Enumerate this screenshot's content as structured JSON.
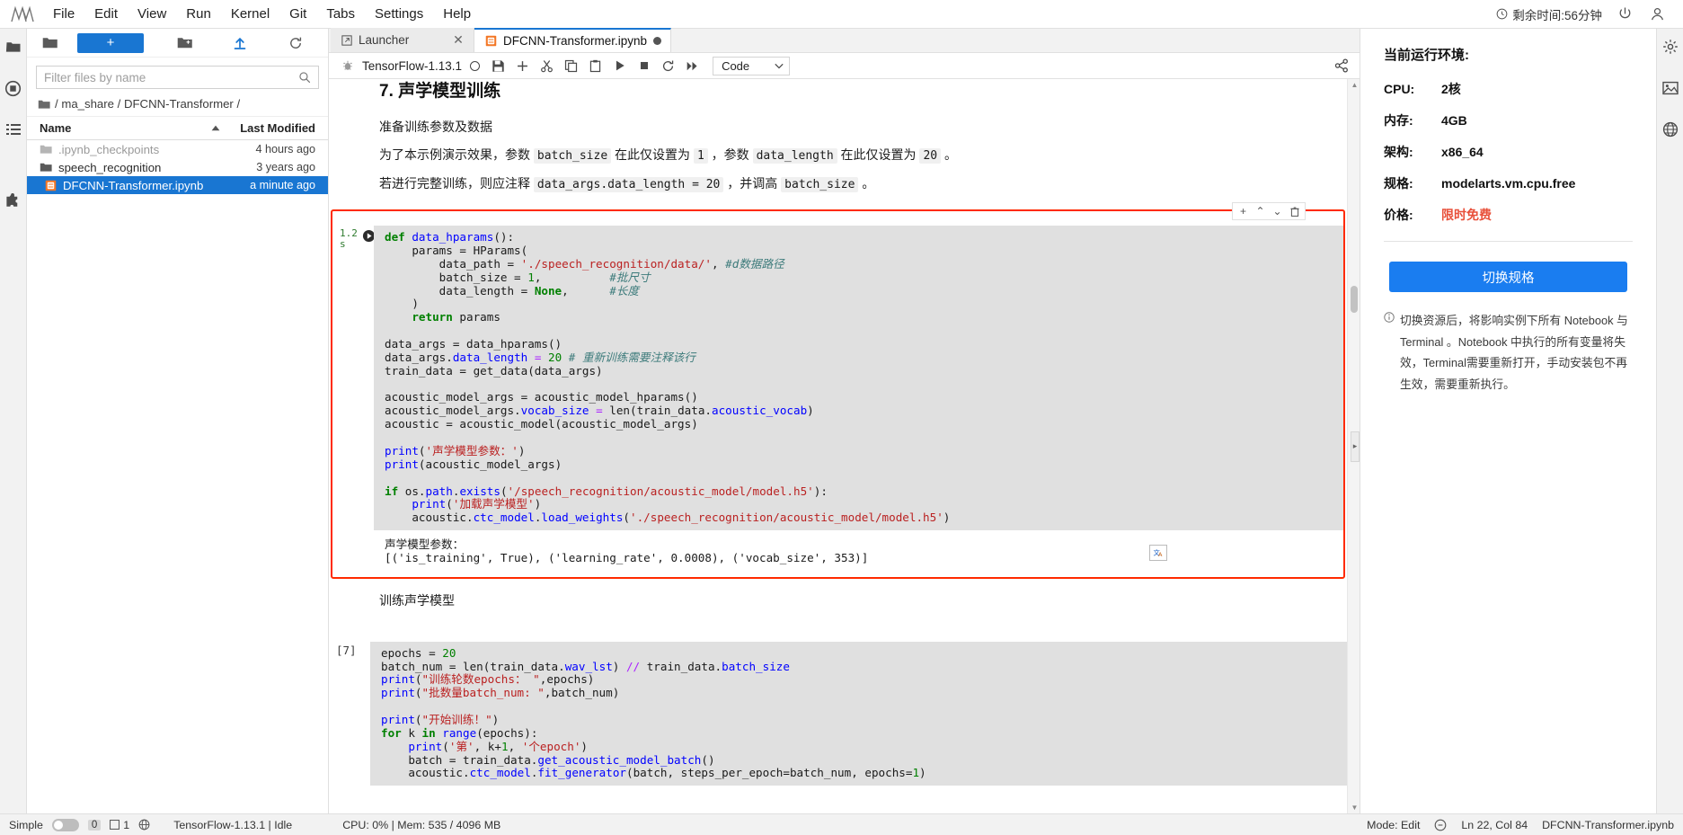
{
  "menubar": {
    "logo_name": "jupyterlab-logo",
    "items": [
      "File",
      "Edit",
      "View",
      "Run",
      "Kernel",
      "Git",
      "Tabs",
      "Settings",
      "Help"
    ],
    "timer_text": "剩余时间:56分钟",
    "power_icon": "power-icon",
    "user_icon": "user-icon"
  },
  "rail": {
    "icons": [
      "folder-icon",
      "running-icon",
      "commands-icon",
      "extensions-icon"
    ]
  },
  "filebrowser": {
    "toolbar": {
      "folder_label": "folder-icon",
      "new_label": "+",
      "new_folder_icon": "new-folder-icon",
      "upload_icon": "upload-icon",
      "refresh_icon": "refresh-icon"
    },
    "filter_placeholder": "Filter files by name",
    "filter_value": "",
    "search_icon": "search-icon",
    "breadcrumb": "/ ma_share / DFCNN-Transformer /",
    "columns": {
      "name": "Name",
      "modified": "Last Modified"
    },
    "sort_icon": "sort-asc-icon",
    "rows": [
      {
        "name": ".ipynb_checkpoints",
        "modified": "4 hours ago",
        "kind": "folder",
        "dim": true,
        "selected": false,
        "dirty": false
      },
      {
        "name": "speech_recognition",
        "modified": "3 years ago",
        "kind": "folder",
        "dim": false,
        "selected": false,
        "dirty": false
      },
      {
        "name": "DFCNN-Transformer.ipynb",
        "modified": "a minute ago",
        "kind": "notebook",
        "dim": false,
        "selected": true,
        "dirty": true
      }
    ]
  },
  "tabbar": {
    "tabs": [
      {
        "label": "Launcher",
        "icon": "launcher-icon",
        "active": false,
        "dirty": false
      },
      {
        "label": "DFCNN-Transformer.ipynb",
        "icon": "notebook-icon",
        "active": true,
        "dirty": true
      }
    ]
  },
  "nbtoolbar": {
    "kernel_icon": "kernel-icon",
    "kernel_name": "TensorFlow-1.13.1",
    "kernel_status": "idle-circle",
    "buttons": [
      "save-icon",
      "add-cell-icon",
      "cut-icon",
      "copy-icon",
      "paste-icon",
      "run-icon",
      "stop-icon",
      "restart-icon",
      "restart-run-all-icon"
    ],
    "celltype_value": "Code",
    "celltype_caret": "chevron-down-icon",
    "share_icon": "share-icon"
  },
  "notebook": {
    "markdown": {
      "heading": "7. 声学模型训练",
      "para1": "准备训练参数及数据",
      "para2_pre": "为了本示例演示效果，参数 ",
      "para2_c1": "batch_size",
      "para2_mid": " 在此仅设置为 ",
      "para2_c2": "1",
      "para2_mid2": " ，参数 ",
      "para2_c3": "data_length",
      "para2_mid3": " 在此仅设置为 ",
      "para2_c4": "20",
      "para2_end": " 。",
      "para3_pre": "若进行完整训练，则应注释 ",
      "para3_c1": "data_args.data_length = 20",
      "para3_mid": " ，并调高 ",
      "para3_c2": "batch_size",
      "para3_end": " 。",
      "para4": "训练声学模型"
    },
    "selected_cell": {
      "exec_time_value": "1.2",
      "exec_time_unit": "s",
      "play_icon": "play-circle-icon",
      "cell_toolbar": [
        "duplicate-icon",
        "move-up-icon",
        "move-down-icon",
        "delete-icon"
      ],
      "code_lines": [
        [
          [
            "k",
            "def "
          ],
          [
            "fn",
            "data_hparams"
          ],
          [
            "pl",
            "():"
          ]
        ],
        [
          [
            "pl",
            "    params = HParams("
          ]
        ],
        [
          [
            "pl",
            "        data_path = "
          ],
          [
            "st",
            "'./speech_recognition/data/'"
          ],
          [
            "pl",
            ", "
          ],
          [
            "cm",
            "#d数据路径"
          ]
        ],
        [
          [
            "pl",
            "        batch_size = "
          ],
          [
            "nu",
            "1"
          ],
          [
            "pl",
            ",          "
          ],
          [
            "cm",
            "#批尺寸"
          ]
        ],
        [
          [
            "pl",
            "        data_length = "
          ],
          [
            "k",
            "None"
          ],
          [
            "pl",
            ",      "
          ],
          [
            "cm",
            "#长度"
          ]
        ],
        [
          [
            "pl",
            "    )"
          ]
        ],
        [
          [
            "pl",
            "    "
          ],
          [
            "k",
            "return"
          ],
          [
            "pl",
            " params"
          ]
        ],
        [
          [
            "pl",
            ""
          ]
        ],
        [
          [
            "pl",
            "data_args = data_hparams()"
          ]
        ],
        [
          [
            "pl",
            "data_args."
          ],
          [
            "bn",
            "data_length"
          ],
          [
            "pl",
            " "
          ],
          [
            "op",
            "="
          ],
          [
            "pl",
            " "
          ],
          [
            "nu",
            "20"
          ],
          [
            "pl",
            " "
          ],
          [
            "cm",
            "# 重新训练需要注释该行"
          ]
        ],
        [
          [
            "pl",
            "train_data = get_data(data_args)"
          ]
        ],
        [
          [
            "pl",
            ""
          ]
        ],
        [
          [
            "pl",
            "acoustic_model_args = acoustic_model_hparams()"
          ]
        ],
        [
          [
            "pl",
            "acoustic_model_args."
          ],
          [
            "bn",
            "vocab_size"
          ],
          [
            "pl",
            " "
          ],
          [
            "op",
            "="
          ],
          [
            "pl",
            " len(train_data."
          ],
          [
            "bn",
            "acoustic_vocab"
          ],
          [
            "pl",
            ")"
          ]
        ],
        [
          [
            "pl",
            "acoustic = acoustic_model(acoustic_model_args)"
          ]
        ],
        [
          [
            "pl",
            ""
          ]
        ],
        [
          [
            "fn",
            "print"
          ],
          [
            "pl",
            "("
          ],
          [
            "st",
            "'声学模型参数："
          ],
          [
            "st",
            "'"
          ],
          [
            "pl",
            ")"
          ]
        ],
        [
          [
            "fn",
            "print"
          ],
          [
            "pl",
            "(acoustic_model_args)"
          ]
        ],
        [
          [
            "pl",
            ""
          ]
        ],
        [
          [
            "k",
            "if"
          ],
          [
            "pl",
            " os."
          ],
          [
            "bn",
            "path"
          ],
          [
            "pl",
            "."
          ],
          [
            "fn",
            "exists"
          ],
          [
            "pl",
            "("
          ],
          [
            "st",
            "'/speech_recognition/acoustic_model/model.h5'"
          ],
          [
            "pl",
            "):"
          ]
        ],
        [
          [
            "pl",
            "    "
          ],
          [
            "fn",
            "print"
          ],
          [
            "pl",
            "("
          ],
          [
            "st",
            "'加载声学模型'"
          ],
          [
            "pl",
            ")"
          ]
        ],
        [
          [
            "pl",
            "    acoustic."
          ],
          [
            "bn",
            "ctc_model"
          ],
          [
            "pl",
            "."
          ],
          [
            "fn",
            "load_weights"
          ],
          [
            "pl",
            "("
          ],
          [
            "st",
            "'./speech_recognition/acoustic_model/model.h5'"
          ],
          [
            "pl",
            ")"
          ]
        ]
      ],
      "output_lines": [
        "声学模型参数：",
        "[('is_training', True), ('learning_rate', 0.0008), ('vocab_size', 353)]"
      ],
      "output_badge_icon": "translate-icon"
    },
    "next_cell": {
      "prompt": "[7]",
      "code_lines": [
        [
          [
            "pl",
            "epochs = "
          ],
          [
            "nu",
            "20"
          ]
        ],
        [
          [
            "pl",
            "batch_num = len(train_data."
          ],
          [
            "bn",
            "wav_lst"
          ],
          [
            "pl",
            ") "
          ],
          [
            "op",
            "//"
          ],
          [
            "pl",
            " train_data."
          ],
          [
            "bn",
            "batch_size"
          ]
        ],
        [
          [
            "fn",
            "print"
          ],
          [
            "pl",
            "("
          ],
          [
            "st",
            "\"训练轮数epochs： \""
          ],
          [
            "pl",
            ",epochs)"
          ]
        ],
        [
          [
            "fn",
            "print"
          ],
          [
            "pl",
            "("
          ],
          [
            "st",
            "\"批数量batch_num: \""
          ],
          [
            "pl",
            ",batch_num)"
          ]
        ],
        [
          [
            "pl",
            ""
          ]
        ],
        [
          [
            "fn",
            "print"
          ],
          [
            "pl",
            "("
          ],
          [
            "st",
            "\"开始训练！\""
          ],
          [
            "pl",
            ")"
          ]
        ],
        [
          [
            "k",
            "for"
          ],
          [
            "pl",
            " k "
          ],
          [
            "k",
            "in"
          ],
          [
            "pl",
            " "
          ],
          [
            "fn",
            "range"
          ],
          [
            "pl",
            "(epochs):"
          ]
        ],
        [
          [
            "pl",
            "    "
          ],
          [
            "fn",
            "print"
          ],
          [
            "pl",
            "("
          ],
          [
            "st",
            "'第'"
          ],
          [
            "pl",
            ", k+"
          ],
          [
            "nu",
            "1"
          ],
          [
            "pl",
            ", "
          ],
          [
            "st",
            "'个epoch'"
          ],
          [
            "pl",
            ")"
          ]
        ],
        [
          [
            "pl",
            "    batch = train_data."
          ],
          [
            "fn",
            "get_acoustic_model_batch"
          ],
          [
            "pl",
            "()"
          ]
        ],
        [
          [
            "pl",
            "    acoustic."
          ],
          [
            "bn",
            "ctc_model"
          ],
          [
            "pl",
            "."
          ],
          [
            "fn",
            "fit_generator"
          ],
          [
            "pl",
            "(batch, steps_per_epoch=batch_num, epochs="
          ],
          [
            "nu",
            "1"
          ],
          [
            "pl",
            ")"
          ]
        ]
      ]
    }
  },
  "rightpanel": {
    "title": "当前运行环境:",
    "rows": [
      {
        "key": "CPU:",
        "value": "2核",
        "highlight": false
      },
      {
        "key": "内存:",
        "value": "4GB",
        "highlight": false
      },
      {
        "key": "架构:",
        "value": "x86_64",
        "highlight": false
      },
      {
        "key": "规格:",
        "value": "modelarts.vm.cpu.free",
        "highlight": false
      },
      {
        "key": "价格:",
        "value": "限时免费",
        "highlight": true
      }
    ],
    "switch_button": "切换规格",
    "note_icon": "info-icon",
    "note": "切换资源后，将影响实例下所有 Notebook 与 Terminal 。Notebook 中执行的所有变量将失效，Terminal需要重新打开，手动安装包不再生效，需要重新执行。"
  },
  "rrail": {
    "icons": [
      "property-inspector-icon",
      "image-icon",
      "globe-icon"
    ]
  },
  "statusbar": {
    "simple_label": "Simple",
    "toggle_state": "off",
    "terminal_count": "0",
    "kernel_count": "1",
    "globe_icon": "globe-icon",
    "kernel_status": "TensorFlow-1.13.1 | Idle",
    "resources": "CPU: 0% | Mem: 535 / 4096 MB",
    "mode": "Mode: Edit",
    "notify_icon": "notification-icon",
    "cursor": "Ln 22, Col 84",
    "filename": "DFCNN-Transformer.ipynb"
  }
}
